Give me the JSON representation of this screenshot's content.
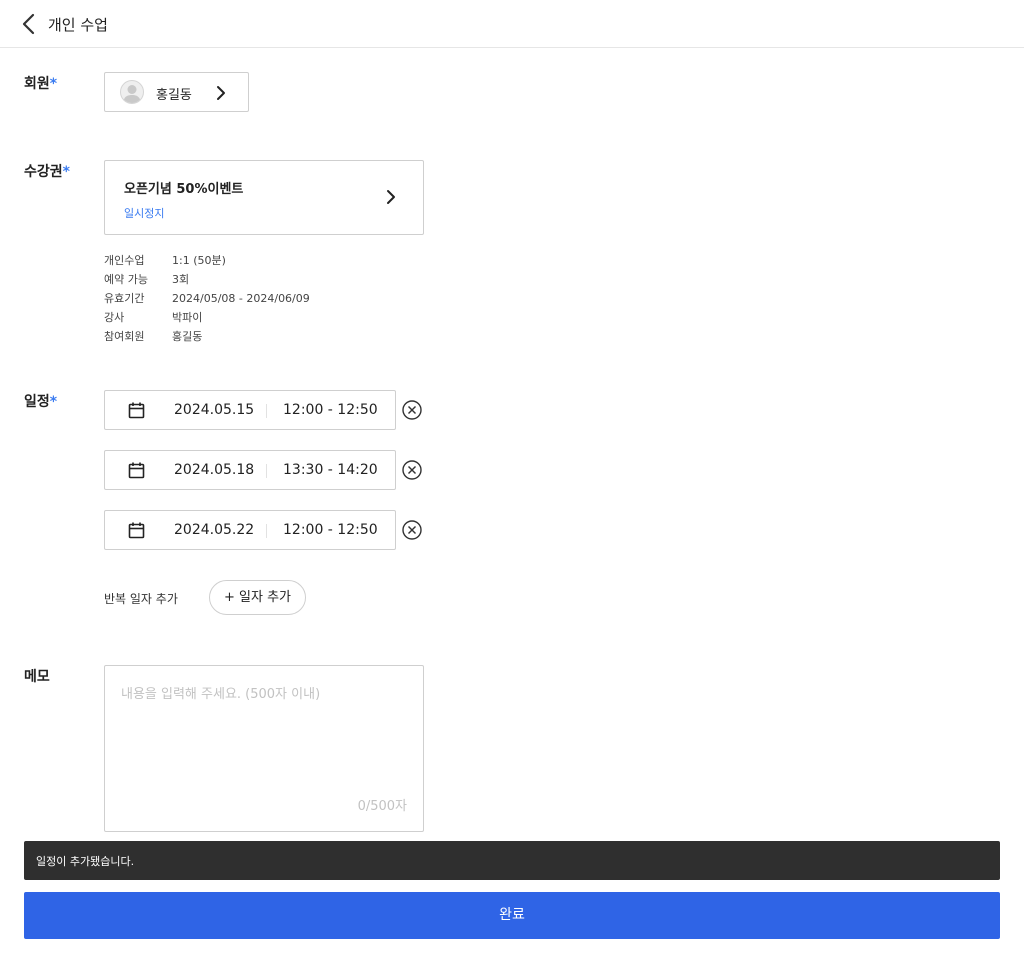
{
  "header": {
    "title": "개인 수업",
    "back_icon": "chevron-left-icon"
  },
  "member": {
    "label": "회원",
    "required_mark": "*",
    "name": "홍길동"
  },
  "pass": {
    "label": "수강권",
    "required_mark": "*",
    "title": "오픈기념 50%이벤트",
    "status": "일시정지",
    "status_color": "#3a7bf0",
    "details": [
      {
        "key": "개인수업",
        "value": "1:1 (50분)"
      },
      {
        "key": "예약 가능",
        "value": "3회"
      },
      {
        "key": "유효기간",
        "value": "2024/05/08 - 2024/06/09"
      },
      {
        "key": "강사",
        "value": "박파이"
      },
      {
        "key": "참여회원",
        "value": "홍길동"
      }
    ]
  },
  "schedule": {
    "label": "일정",
    "required_mark": "*",
    "items": [
      {
        "date": "2024.05.15",
        "time": "12:00 - 12:50"
      },
      {
        "date": "2024.05.18",
        "time": "13:30 - 14:20"
      },
      {
        "date": "2024.05.22",
        "time": "12:00 - 12:50"
      }
    ],
    "repeat_label": "반복 일자 추가",
    "add_button": "+ 일자 추가"
  },
  "memo": {
    "label": "메모",
    "placeholder": "내용을 입력해 주세요. (500자 이내)",
    "value": "",
    "count": "0/500자"
  },
  "toast": {
    "message": "일정이 추가됐습니다."
  },
  "submit": {
    "label": "완료",
    "color": "#2f64e6"
  }
}
